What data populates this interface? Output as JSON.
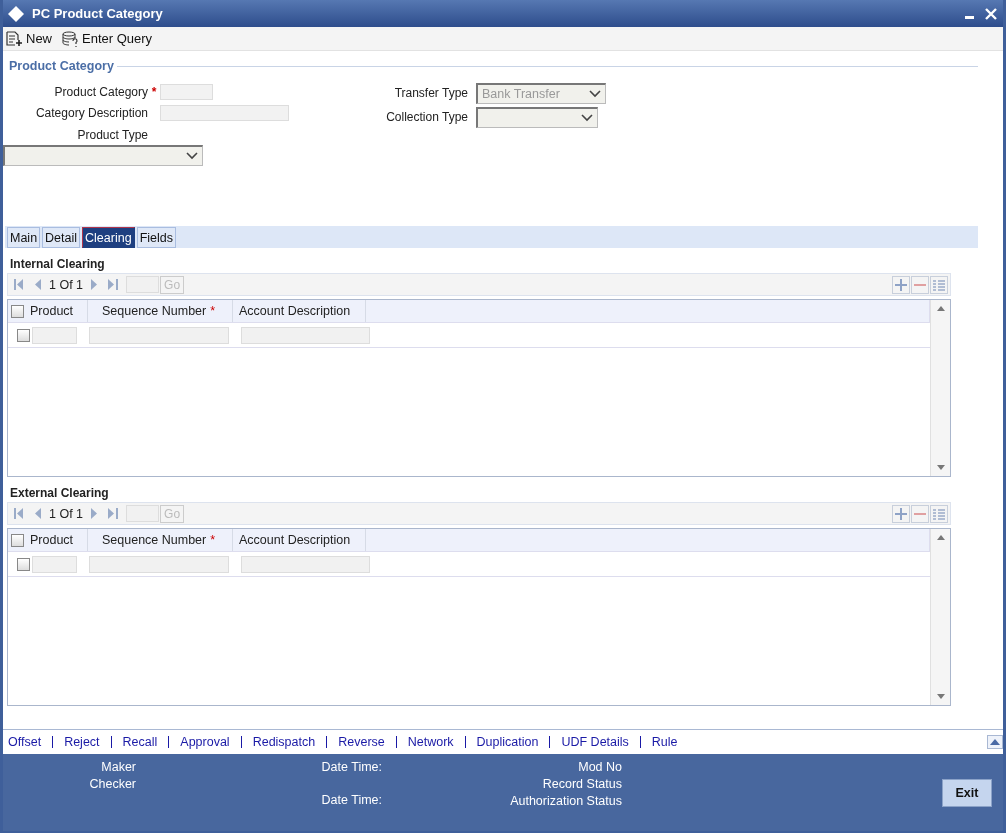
{
  "window": {
    "title": "PC Product Category"
  },
  "toolbar": [
    {
      "label": "New",
      "kind": "new"
    },
    {
      "label": "Enter Query",
      "kind": "query"
    }
  ],
  "section": {
    "title": "Product Category"
  },
  "form": {
    "product_category": {
      "label": "Product Category",
      "marker": "*"
    },
    "category_description": {
      "label": "Category Description"
    },
    "product_type": {
      "label": "Product Type"
    },
    "transfer_type": {
      "label": "Transfer Type",
      "value": "Bank Transfer",
      "disabled": true
    },
    "collection_type": {
      "label": "Collection Type"
    }
  },
  "tabs": [
    {
      "label": "Main",
      "selected": false
    },
    {
      "label": "Detail",
      "selected": false
    },
    {
      "label": "Clearing",
      "selected": true
    },
    {
      "label": "Fields",
      "selected": false
    }
  ],
  "grids": [
    {
      "title": "Internal Clearing",
      "pager": "1 Of 1",
      "go": "Go",
      "select_all": false,
      "columns": [
        {
          "label": "Product"
        },
        {
          "label": "Sequence Number",
          "marker": "*"
        },
        {
          "label": "Account Description"
        }
      ],
      "rows": [
        {
          "checked": false
        }
      ]
    },
    {
      "title": "External Clearing",
      "pager": "1 Of 1",
      "go": "Go",
      "select_all": false,
      "columns": [
        {
          "label": "Product"
        },
        {
          "label": "Sequence Number",
          "marker": "*"
        },
        {
          "label": "Account Description"
        }
      ],
      "rows": [
        {
          "checked": false
        }
      ]
    }
  ],
  "links": [
    "Offset",
    "Reject",
    "Recall",
    "Approval",
    "Redispatch",
    "Reverse",
    "Network",
    "Duplication",
    "UDF Details",
    "Rule"
  ],
  "footer": {
    "maker": "Maker",
    "checker": "Checker",
    "date_time_1": "Date Time:",
    "date_time_2": "Date Time:",
    "mod_no": "Mod No",
    "record_status": "Record Status",
    "authorization_status": "Authorization Status",
    "exit": "Exit"
  }
}
